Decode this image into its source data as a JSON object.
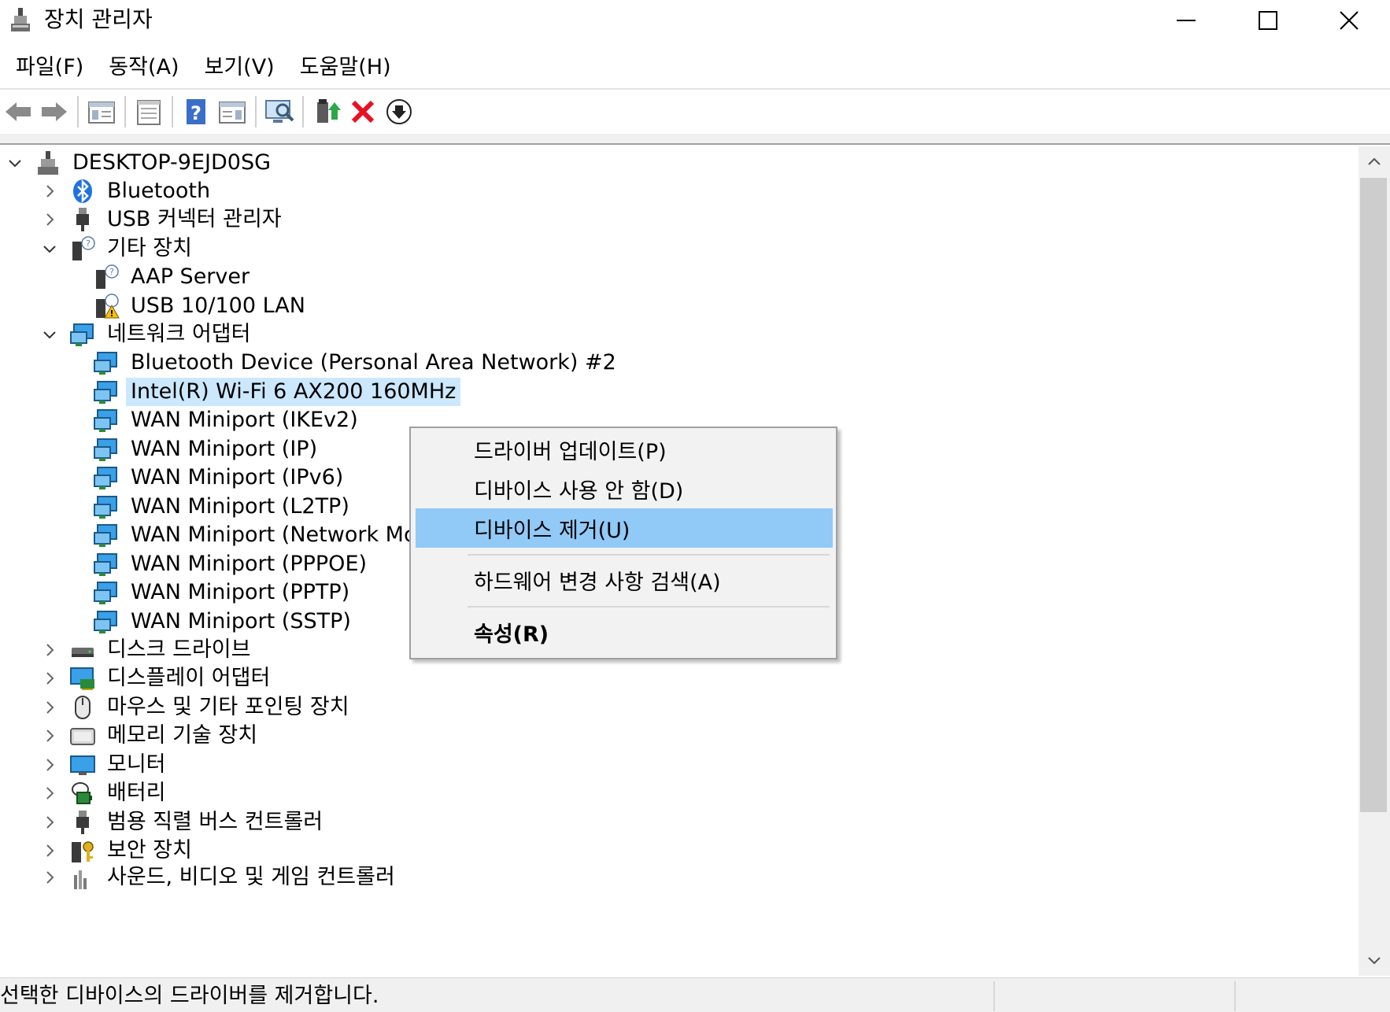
{
  "window": {
    "title": "장치 관리자",
    "icon": "device-manager-icon"
  },
  "menubar": [
    "파일(F)",
    "동작(A)",
    "보기(V)",
    "도움말(H)"
  ],
  "toolbar": {
    "buttons": [
      "back-icon",
      "forward-icon",
      "show-hide-console-tree-icon",
      "properties-icon",
      "help-icon",
      "action-pane-icon",
      "scan-hardware-icon",
      "update-driver-icon",
      "uninstall-icon",
      "enable-device-icon"
    ]
  },
  "tree": {
    "root": "DESKTOP-9EJD0SG",
    "categories": {
      "bluetooth": "Bluetooth",
      "usb_connector": "USB 커넥터 관리자",
      "other": "기타 장치",
      "network": "네트워크 어댑터",
      "disk": "디스크 드라이브",
      "display": "디스플레이 어댑터",
      "mouse": "마우스 및 기타 포인팅 장치",
      "memory": "메모리 기술 장치",
      "monitor": "모니터",
      "battery": "배터리",
      "usb_bus": "범용 직렬 버스 컨트롤러",
      "security": "보안 장치",
      "sound": "사운드, 비디오 및 게임 컨트롤러"
    },
    "other_devices": [
      "AAP Server",
      "USB 10/100 LAN"
    ],
    "network_adapters": [
      "Bluetooth Device (Personal Area Network) #2",
      "Intel(R) Wi-Fi 6 AX200 160MHz",
      "WAN Miniport (IKEv2)",
      "WAN Miniport (IP)",
      "WAN Miniport (IPv6)",
      "WAN Miniport (L2TP)",
      "WAN Miniport (Network Mc",
      "WAN Miniport (PPPOE)",
      "WAN Miniport (PPTP)",
      "WAN Miniport (SSTP)"
    ],
    "selected": "Intel(R) Wi-Fi 6 AX200 160MHz"
  },
  "context_menu": {
    "update_driver": "드라이버 업데이트(P)",
    "disable_device": "디바이스 사용 안 함(D)",
    "uninstall_device": "디바이스 제거(U)",
    "scan_hardware": "하드웨어 변경 사항 검색(A)",
    "properties": "속성(R)",
    "highlighted": "디바이스 제거(U)"
  },
  "status": {
    "text": "선택한 디바이스의 드라이버를 제거합니다."
  },
  "colors": {
    "selection": "#cce8ff",
    "menu_highlight": "#91c9f7",
    "uninstall_red": "#e81123"
  }
}
